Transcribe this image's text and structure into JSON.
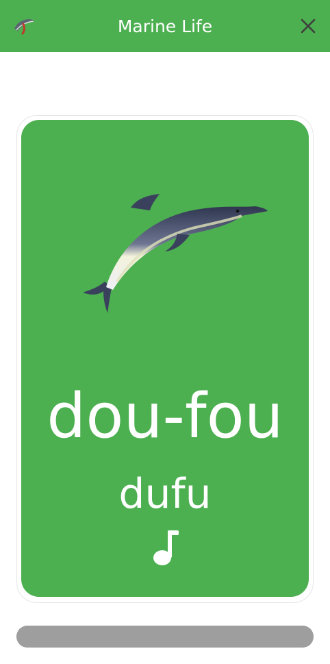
{
  "header": {
    "title": "Marine Life",
    "logo_icon": "dolphin-logo-icon",
    "close_icon": "close-icon",
    "color": "#4caf50"
  },
  "card": {
    "color": "#4caf50",
    "image_icon": "dolphin-image",
    "word": "dou-fou",
    "phonetic": "dufu",
    "sound_icon": "music-note-icon"
  },
  "progress": {
    "value": 1.0,
    "color": "#9e9e9e"
  }
}
